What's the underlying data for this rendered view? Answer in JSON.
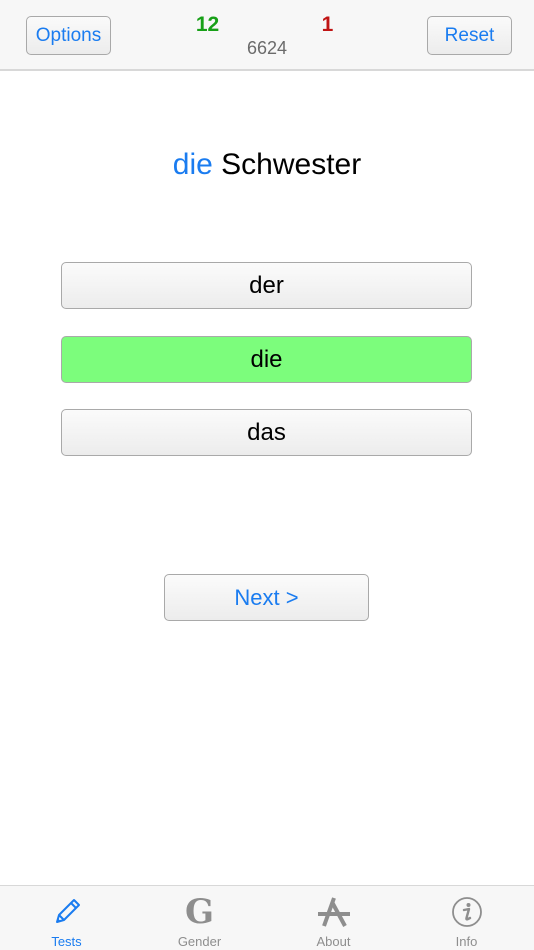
{
  "header": {
    "options_label": "Options",
    "reset_label": "Reset",
    "correct_count": "12",
    "wrong_count": "1",
    "total_count": "6624"
  },
  "question": {
    "article": "die",
    "noun": "Schwester"
  },
  "choices": [
    {
      "label": "der",
      "state": "normal"
    },
    {
      "label": "die",
      "state": "correct"
    },
    {
      "label": "das",
      "state": "normal"
    }
  ],
  "next_label": "Next >",
  "tabs": [
    {
      "label": "Tests",
      "icon": "pencil-icon",
      "active": true
    },
    {
      "label": "Gender",
      "icon": "g-letter-icon",
      "glyph": "G",
      "active": false
    },
    {
      "label": "About",
      "icon": "app-store-icon",
      "active": false
    },
    {
      "label": "Info",
      "icon": "info-icon",
      "active": false
    }
  ],
  "colors": {
    "accent": "#1a7cf0",
    "correct": "#18a018",
    "wrong": "#c01414",
    "correct_answer_bg": "#7cfd7c"
  }
}
